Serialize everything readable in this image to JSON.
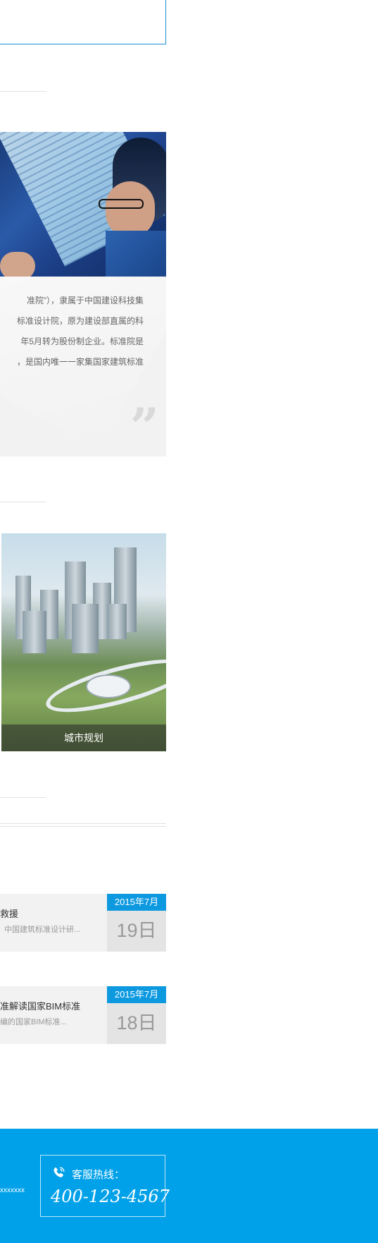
{
  "about": {
    "quote_lines": [
      "准院”），隶属于中国建设科技集",
      "标准设计院，原为建设部直属的科",
      "年5月转为股份制企业。标准院是",
      "，是国内唯一一家集国家建筑标准"
    ],
    "quote_mark": "”"
  },
  "projects": {
    "caption": "城市规划"
  },
  "news": {
    "items": [
      {
        "title": "救援",
        "summary": "中国建筑标准设计研...",
        "month": "2015年7月",
        "day": "19日"
      },
      {
        "title": "准解读国家BIM标准",
        "summary": "编的国家BIM标准...",
        "month": "2015年7月",
        "day": "18日"
      }
    ]
  },
  "footer": {
    "address_tail": "xxxxxxx",
    "hotline_label": "客服热线：",
    "hotline_number": "400-123-4567",
    "icons": {
      "phone": "phone-icon"
    }
  },
  "colors": {
    "accent": "#00a1e9",
    "date_badge": "#0d99e0"
  }
}
